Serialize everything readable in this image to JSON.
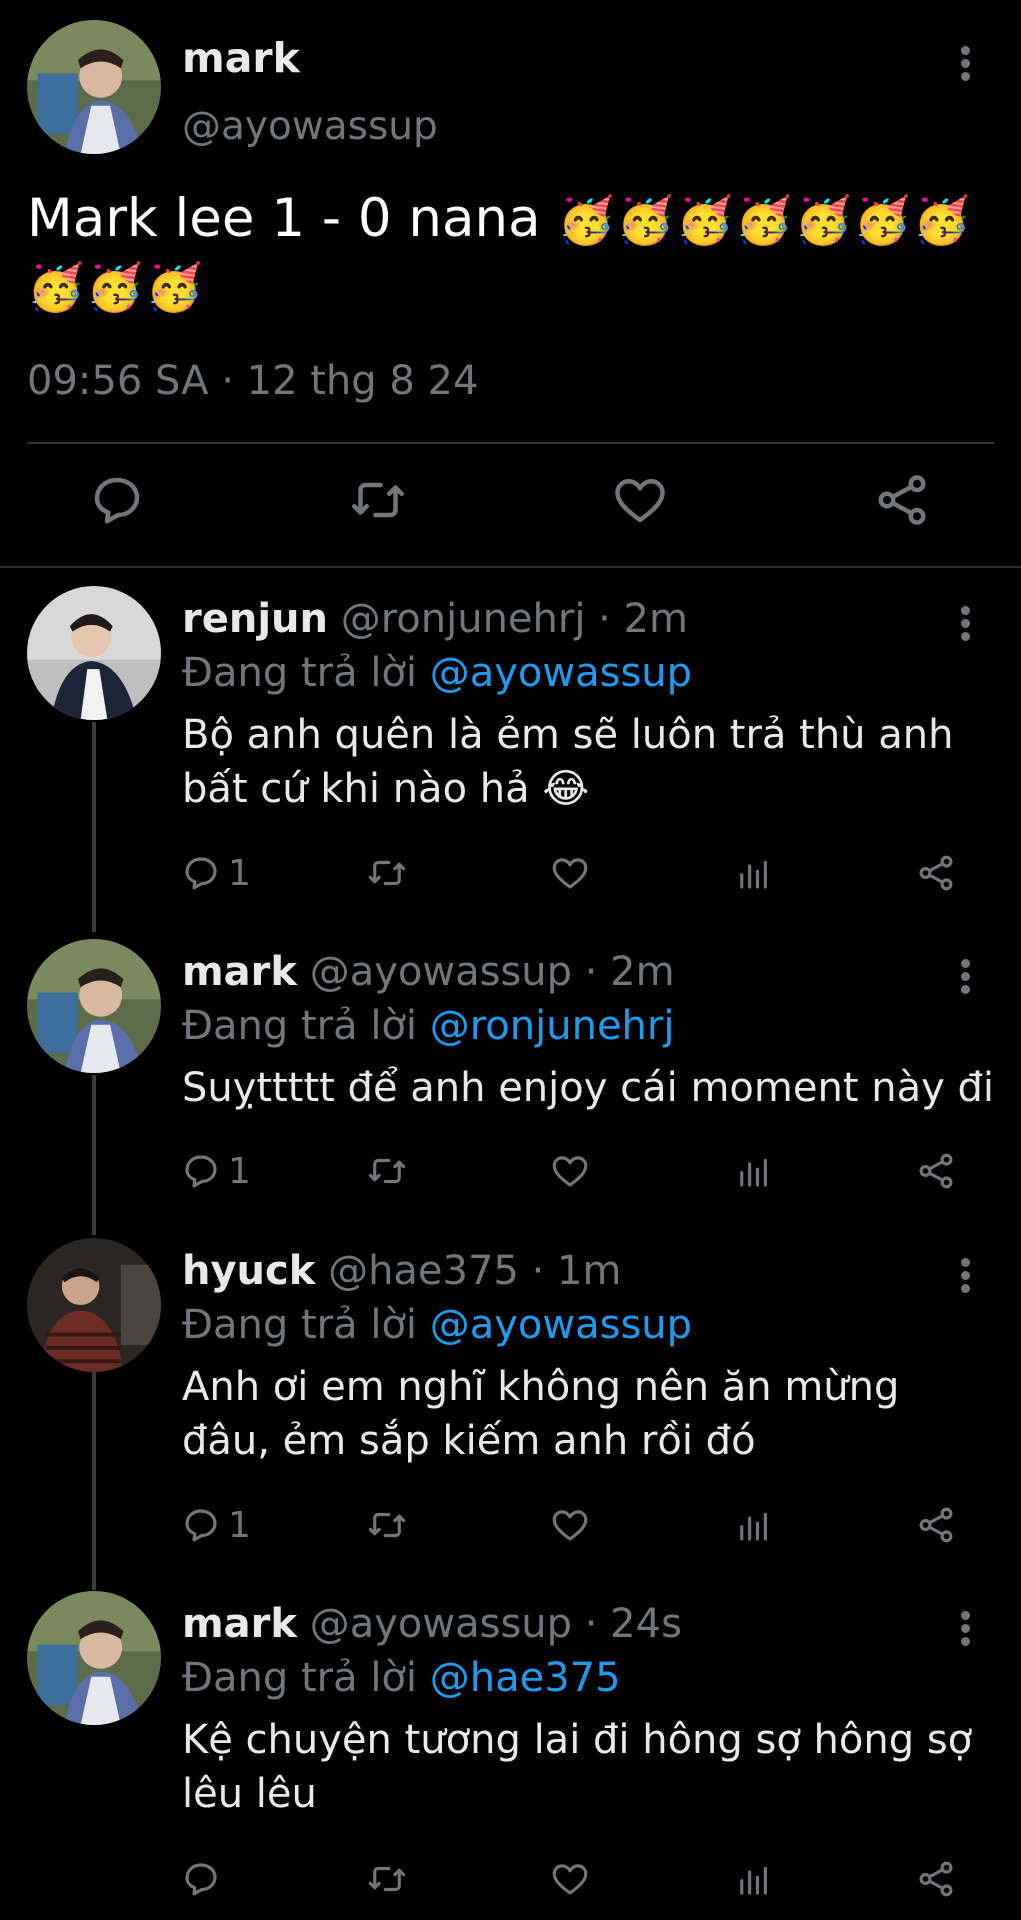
{
  "main_tweet": {
    "name": "mark",
    "handle": "@ayowassup",
    "text": "Mark lee 1 - 0 nana",
    "emojis": "🥳🥳🥳🥳🥳🥳🥳🥳🥳🥳",
    "timestamp": "09:56 SA · 12 thg 8 24"
  },
  "replies": [
    {
      "name": "renjun",
      "handle": "@ronjunehrj · 2m",
      "replying_prefix": "Đang trả lời ",
      "replying_to": "@ayowassup",
      "text": "Bộ anh quên là ẻm sẽ luôn trả thù anh bất cứ khi nào hả 😂",
      "reply_count": "1"
    },
    {
      "name": "mark",
      "handle": "@ayowassup · 2m",
      "replying_prefix": "Đang trả lời ",
      "replying_to": "@ronjunehrj",
      "text": "Suỵttttt để anh enjoy cái moment này đi",
      "reply_count": "1"
    },
    {
      "name": "hyuck",
      "handle": "@hae375 · 1m",
      "replying_prefix": "Đang trả lời ",
      "replying_to": "@ayowassup",
      "text": "Anh ơi em nghĩ không nên ăn mừng đâu, ẻm sắp kiếm anh rồi đó",
      "reply_count": "1"
    },
    {
      "name": "mark",
      "handle": "@ayowassup · 24s",
      "replying_prefix": "Đang trả lời ",
      "replying_to": "@hae375",
      "text": "Kệ chuyện tương lai đi hông sợ hông sợ lêu lêu",
      "reply_count": ""
    }
  ],
  "icons": [
    "reply-icon",
    "retweet-icon",
    "like-icon",
    "views-icon",
    "share-icon",
    "more-icon"
  ],
  "colors": {
    "background": "#000000",
    "text": "#e7e9ea",
    "muted": "#71767b",
    "accent": "#1d9bf0",
    "divider": "#2f3336"
  }
}
